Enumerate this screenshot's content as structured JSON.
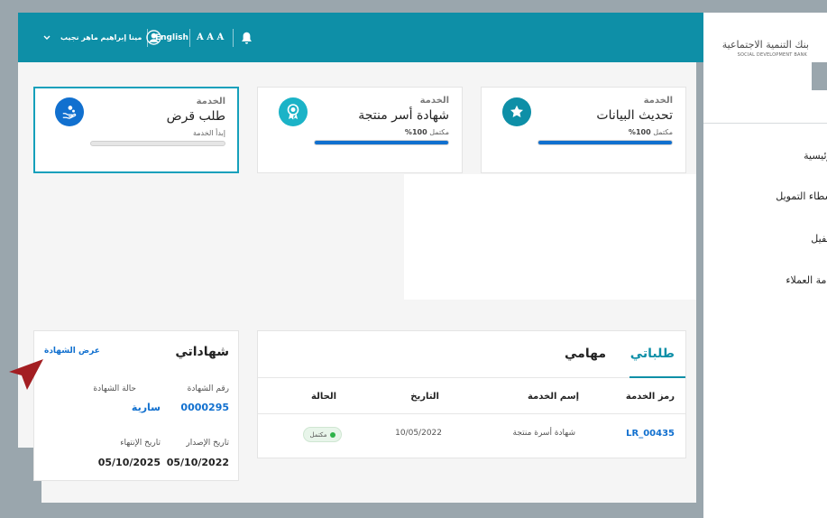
{
  "topbar": {
    "user_name": "مينا إبراهيم ماهر نجيب",
    "language": "English",
    "font_size_label": "A A A",
    "notifications_icon": "bell-icon",
    "user_icon": "user-icon",
    "dropdown_icon": "chevron-down-icon"
  },
  "sidebar": {
    "logo_ar": "بنك التنمية الاجتماعية",
    "logo_en": "SOCIAL DEVELOPMENT BANK",
    "items": [
      {
        "label": "الرئيسية"
      },
      {
        "label": "وسطاء التمويل"
      },
      {
        "label": "الكفيل"
      },
      {
        "label": "خدمة العملاء"
      }
    ]
  },
  "services": [
    {
      "label": "الخدمة",
      "name": "تحديث البيانات",
      "status_prefix": "مكتمل",
      "status_value": "100%",
      "progress": 1.0,
      "icon": "star-icon",
      "icon_color": "#0e8fa7"
    },
    {
      "label": "الخدمة",
      "name": "شهادة أسر منتجة",
      "status_prefix": "مكتمل",
      "status_value": "100%",
      "progress": 1.0,
      "icon": "award-icon",
      "icon_color": "#1bb3c7"
    },
    {
      "label": "الخدمة",
      "name": "طلب قرض",
      "status_prefix": "إبدأ الخدمة",
      "status_value": "",
      "progress": 0,
      "icon": "loan-hand-icon",
      "icon_color": "#1170cf"
    }
  ],
  "requests": {
    "tab_active": "طلباتي",
    "tab_inactive": "مهامي",
    "columns": [
      "رمز الخدمة",
      "إسم الخدمة",
      "التاريخ",
      "الحالة"
    ],
    "rows": [
      {
        "code": "LR_00435",
        "service": "شهادة أسرة منتجة",
        "date": "10/05/2022",
        "status": "مكتمل"
      }
    ]
  },
  "certificates": {
    "title": "شهاداتي",
    "view_link": "عرض الشهادة",
    "number_label": "رقم الشهادة",
    "number_value": "0000295",
    "status_label": "حالة الشهادة",
    "status_value": "سارية",
    "issue_label": "تاريخ الإصدار",
    "issue_value": "05/10/2022",
    "expiry_label": "تاريخ الإنتهاء",
    "expiry_value": "05/10/2025"
  },
  "colors": {
    "primary": "#0e8fa7",
    "link": "#1170cf",
    "success": "#2fb34a",
    "pointer": "#a31e22"
  }
}
